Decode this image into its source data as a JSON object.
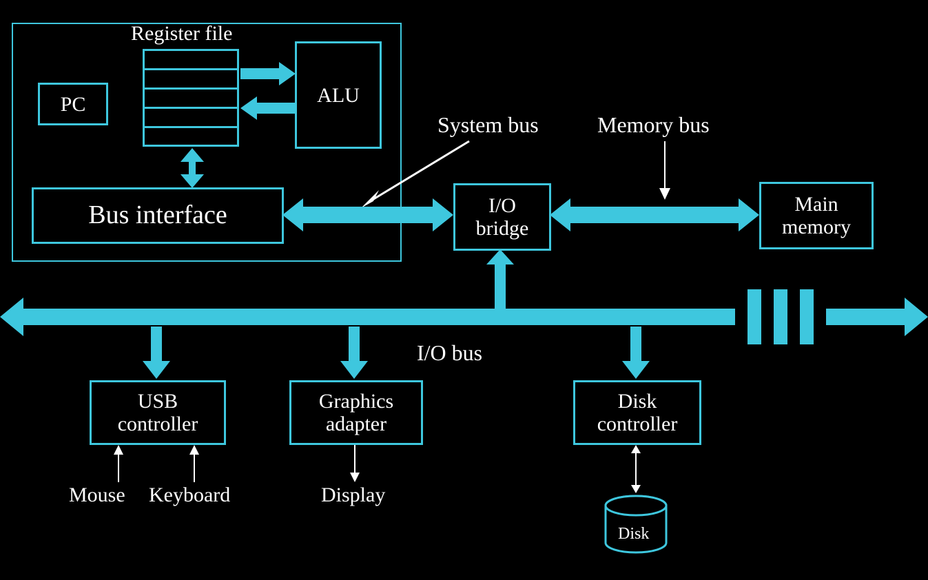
{
  "colors": {
    "accent": "#3EC7DE",
    "bg": "#000000",
    "fg": "#FFFFFF"
  },
  "cpu": {
    "register_file_label": "Register file",
    "pc": "PC",
    "alu": "ALU",
    "bus_interface": "Bus interface"
  },
  "buses": {
    "system_bus": "System bus",
    "memory_bus": "Memory bus",
    "io_bus": "I/O bus"
  },
  "blocks": {
    "io_bridge": "I/O\nbridge",
    "main_memory": "Main\nmemory",
    "usb_controller": "USB\ncontroller",
    "graphics_adapter": "Graphics\nadapter",
    "disk_controller": "Disk\ncontroller",
    "disk": "Disk"
  },
  "peripherals": {
    "mouse": "Mouse",
    "keyboard": "Keyboard",
    "display": "Display"
  }
}
